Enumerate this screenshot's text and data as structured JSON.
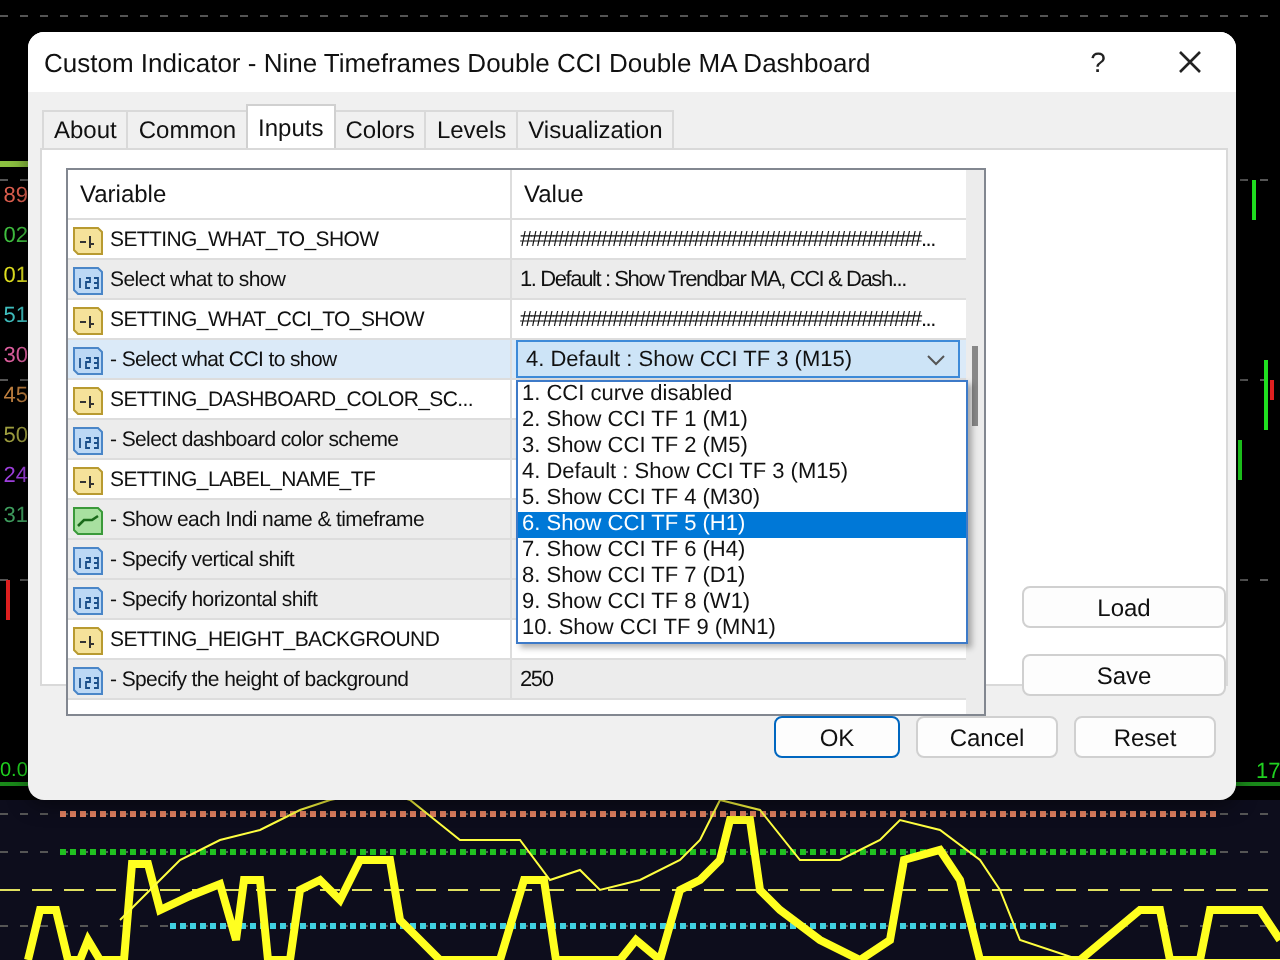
{
  "window": {
    "title": "Custom Indicator - Nine Timeframes Double CCI Double MA Dashboard",
    "help": "?"
  },
  "chart_edge_labels": [
    {
      "text": "89",
      "color": "#e06050"
    },
    {
      "text": "02",
      "color": "#40c040"
    },
    {
      "text": "01",
      "color": "#e0e020"
    },
    {
      "text": "51",
      "color": "#40c0c0"
    },
    {
      "text": "30",
      "color": "#e060a0"
    },
    {
      "text": "45",
      "color": "#c08040"
    },
    {
      "text": "50",
      "color": "#a0a040"
    },
    {
      "text": "24",
      "color": "#a040e0"
    },
    {
      "text": "31",
      "color": "#40a060"
    }
  ],
  "chart_price_labels": [
    "0.0",
    "17"
  ],
  "tabs": [
    {
      "label": "About",
      "selected": false
    },
    {
      "label": "Common",
      "selected": false
    },
    {
      "label": "Inputs",
      "selected": true
    },
    {
      "label": "Colors",
      "selected": false
    },
    {
      "label": "Levels",
      "selected": false
    },
    {
      "label": "Visualization",
      "selected": false
    }
  ],
  "table": {
    "columns": [
      "Variable",
      "Value"
    ],
    "rows": [
      {
        "kind": "text",
        "variable": "SETTING_WHAT_TO_SHOW",
        "value": "#####################################...",
        "selected": false
      },
      {
        "kind": "int",
        "variable": "Select what to show",
        "value": "1. Default : Show Trendbar MA, CCI & Dash...",
        "selected": false
      },
      {
        "kind": "text",
        "variable": "SETTING_WHAT_CCI_TO_SHOW",
        "value": "#####################################...",
        "selected": false
      },
      {
        "kind": "int",
        "variable": "- Select what CCI to show",
        "value": "4. Default : Show CCI TF 3 (M15)",
        "selected": true
      },
      {
        "kind": "text",
        "variable": "SETTING_DASHBOARD_COLOR_SC...",
        "value": "",
        "selected": false
      },
      {
        "kind": "int",
        "variable": "- Select dashboard color scheme",
        "value": "",
        "selected": false
      },
      {
        "kind": "text",
        "variable": "SETTING_LABEL_NAME_TF",
        "value": "",
        "selected": false
      },
      {
        "kind": "bool",
        "variable": "- Show each Indi name & timeframe",
        "value": "",
        "selected": false
      },
      {
        "kind": "int",
        "variable": "- Specify vertical shift",
        "value": "",
        "selected": false
      },
      {
        "kind": "int",
        "variable": "- Specify horizontal shift",
        "value": "",
        "selected": false
      },
      {
        "kind": "text",
        "variable": "SETTING_HEIGHT_BACKGROUND",
        "value": "",
        "selected": false
      },
      {
        "kind": "int",
        "variable": "- Specify the height of background",
        "value": "250",
        "selected": false
      }
    ]
  },
  "dropdown": {
    "items": [
      {
        "label": "1. CCI curve disabled",
        "selected": false
      },
      {
        "label": "2. Show CCI TF 1 (M1)",
        "selected": false
      },
      {
        "label": "3. Show CCI TF 2 (M5)",
        "selected": false
      },
      {
        "label": "4. Default : Show CCI TF 3 (M15)",
        "selected": false
      },
      {
        "label": "5. Show CCI TF 4 (M30)",
        "selected": false
      },
      {
        "label": "6. Show CCI TF 5 (H1)",
        "selected": true
      },
      {
        "label": "7. Show CCI TF 6 (H4)",
        "selected": false
      },
      {
        "label": "8. Show CCI TF 7 (D1)",
        "selected": false
      },
      {
        "label": "9. Show CCI TF 8 (W1)",
        "selected": false
      },
      {
        "label": "10. Show CCI TF 9 (MN1)",
        "selected": false
      }
    ]
  },
  "side_buttons": [
    "Load",
    "Save"
  ],
  "buttons": [
    {
      "label": "OK",
      "default": true
    },
    {
      "label": "Cancel",
      "default": false
    },
    {
      "label": "Reset",
      "default": false
    }
  ]
}
